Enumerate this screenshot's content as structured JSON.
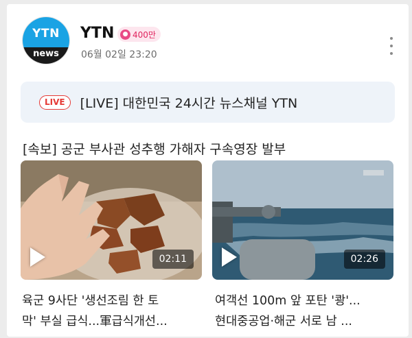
{
  "channel": {
    "logo_top": "YTN",
    "logo_bottom": "news",
    "name": "YTN",
    "subscribers": "400만",
    "date": "06월 02일 23:20"
  },
  "live": {
    "tag": "LIVE",
    "title": "[LIVE] 대한민국 24시간 뉴스채널 YTN"
  },
  "section": {
    "title": "[속보] 공군 부사관 성추행 가해자 구속영장 발부"
  },
  "videos": [
    {
      "duration": "02:11",
      "title_line1": "육군 9사단 '생선조림 한 토",
      "title_line2": "막' 부실 급식...軍급식개선..."
    },
    {
      "duration": "02:26",
      "title_line1": "여객선 100m 앞 포탄 '쾅'...",
      "title_line2": "현대중공업·해군 서로 남 ..."
    }
  ],
  "colors": {
    "live_red": "#e53935",
    "live_bg": "#eef3f9",
    "badge_pink": "#e94a86",
    "logo_blue": "#1aa3e4"
  }
}
